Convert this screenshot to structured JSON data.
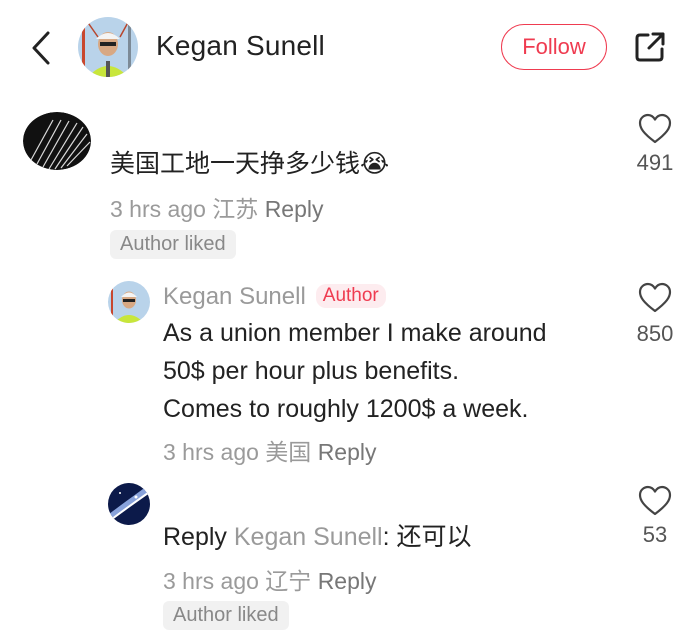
{
  "header": {
    "user_name": "Kegan Sunell",
    "follow_label": "Follow"
  },
  "comments": [
    {
      "text": "美国工地一天挣多少钱",
      "emoji": "😭",
      "time": "3 hrs ago",
      "location": "江苏",
      "reply_label": "Reply",
      "likes": "491",
      "badge": "Author liked"
    },
    {
      "author": "Kegan Sunell",
      "author_tag": "Author",
      "lines": [
        "As a union member I make around",
        "50$ per hour plus benefits.",
        "Comes to roughly 1200$ a week."
      ],
      "time": "3 hrs ago",
      "location": "美国",
      "reply_label": "Reply",
      "likes": "850"
    },
    {
      "reply_prefix": "Reply",
      "reply_to": "Kegan Sunell",
      "text": ": 还可以",
      "time": "3 hrs ago",
      "location": "辽宁",
      "reply_label": "Reply",
      "likes": "53",
      "badge": "Author liked"
    }
  ],
  "colors": {
    "accent": "#ef3b50",
    "muted": "#9a9a9a"
  }
}
